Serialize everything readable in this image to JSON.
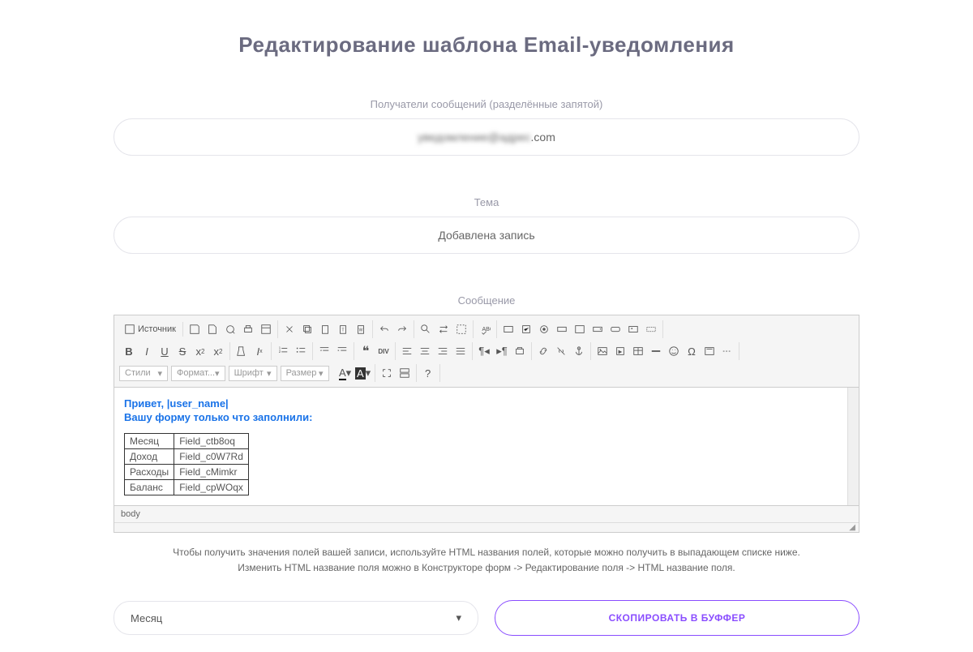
{
  "title": "Редактирование шаблона Email-уведомления",
  "recipients": {
    "label": "Получатели сообщений (разделённые запятой)",
    "value_prefix": "уведомление@адрес",
    "value_suffix": ".com"
  },
  "subject": {
    "label": "Тема",
    "value": "Добавлена запись"
  },
  "message": {
    "label": "Сообщение",
    "greeting": "Привет, |user_name|",
    "subhead": "Вашу форму только что заполнили:",
    "table": [
      {
        "label": "Месяц",
        "field": "Field_ctb8oq"
      },
      {
        "label": "Доход",
        "field": "Field_c0W7Rd"
      },
      {
        "label": "Расходы",
        "field": "Field_cMimkr"
      },
      {
        "label": "Баланс",
        "field": "Field_cpWOqx"
      }
    ],
    "path": "body"
  },
  "toolbar": {
    "source": "Источник",
    "styles": "Стили",
    "format": "Формат...",
    "font": "Шрифт",
    "size": "Размер"
  },
  "help": {
    "line1": "Чтобы получить значения полей вашей записи, используйте HTML названия полей, которые можно получить в выпадающем списке ниже.",
    "line2": "Изменить HTML название поля можно в Конструкторе форм -> Редактирование поля -> HTML название поля."
  },
  "fieldSelect": {
    "value": "Месяц"
  },
  "copyButton": "СКОПИРОВАТЬ В БУФФЕР"
}
